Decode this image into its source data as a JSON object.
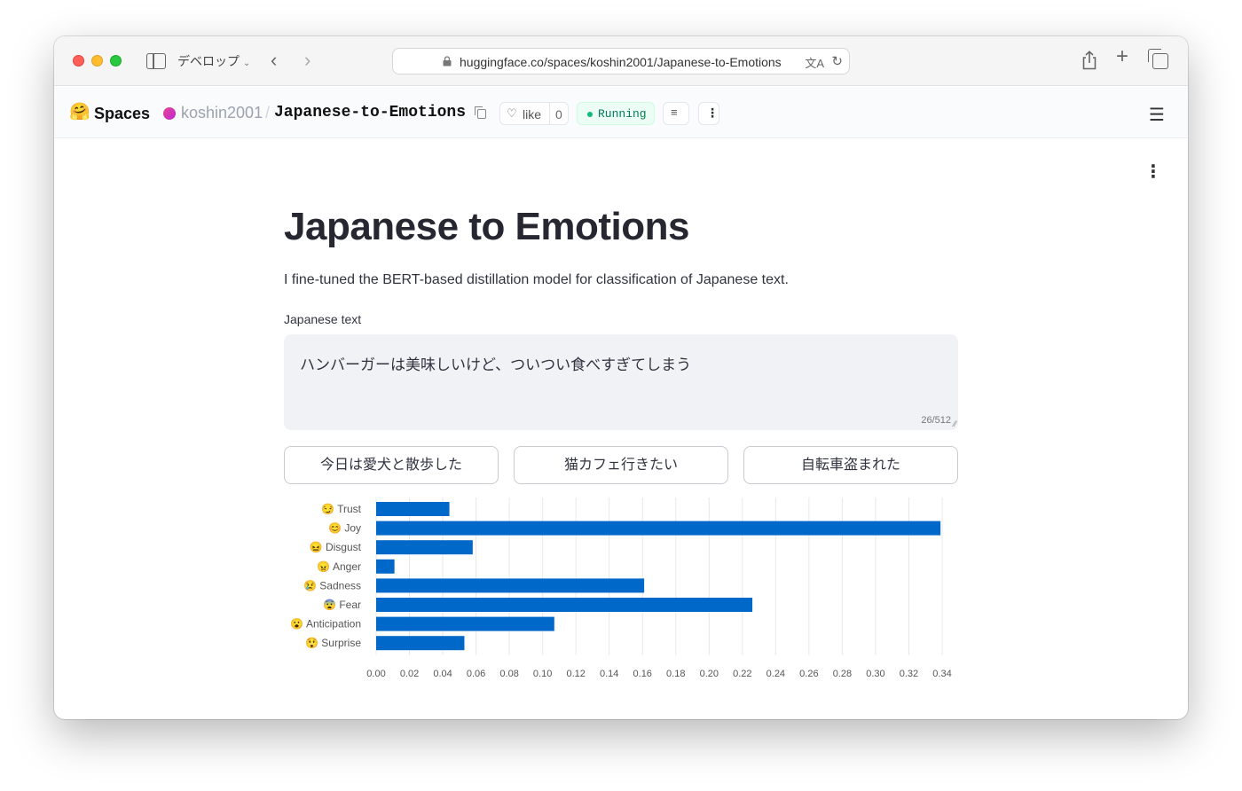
{
  "browser": {
    "tab_group": "デベロップ",
    "url": "huggingface.co/spaces/koshin2001/Japanese-to-Emotions"
  },
  "hf": {
    "brand": "Spaces",
    "owner": "koshin2001",
    "separator": "/",
    "repo": "Japanese-to-Emotions",
    "like_label": "like",
    "like_count": "0",
    "status": "Running"
  },
  "app": {
    "title": "Japanese to Emotions",
    "description": "I fine-tuned the BERT-based distillation model for classification of Japanese text.",
    "input_label": "Japanese text",
    "input_value": "ハンバーガーは美味しいけど、ついつい食べすぎてしまう",
    "char_counter": "26/512",
    "examples": [
      "今日は愛犬と散歩した",
      "猫カフェ行きたい",
      "自転車盗まれた"
    ]
  },
  "colors": {
    "bar": "#0068c9",
    "grid": "#e6e8ec",
    "running_bg": "#ecfdf5",
    "running_text": "#047857"
  },
  "chart_data": {
    "type": "bar",
    "orientation": "horizontal",
    "categories": [
      "😏 Trust",
      "😊 Joy",
      "😖 Disgust",
      "😠 Anger",
      "😢 Sadness",
      "😨 Fear",
      "😮 Anticipation",
      "😲 Surprise"
    ],
    "values": [
      0.044,
      0.339,
      0.058,
      0.011,
      0.161,
      0.226,
      0.107,
      0.053
    ],
    "xlim": [
      0,
      0.34
    ],
    "xticks": [
      "0.00",
      "0.02",
      "0.04",
      "0.06",
      "0.08",
      "0.10",
      "0.12",
      "0.14",
      "0.16",
      "0.18",
      "0.20",
      "0.22",
      "0.24",
      "0.26",
      "0.28",
      "0.30",
      "0.32",
      "0.34"
    ],
    "grid": true
  }
}
